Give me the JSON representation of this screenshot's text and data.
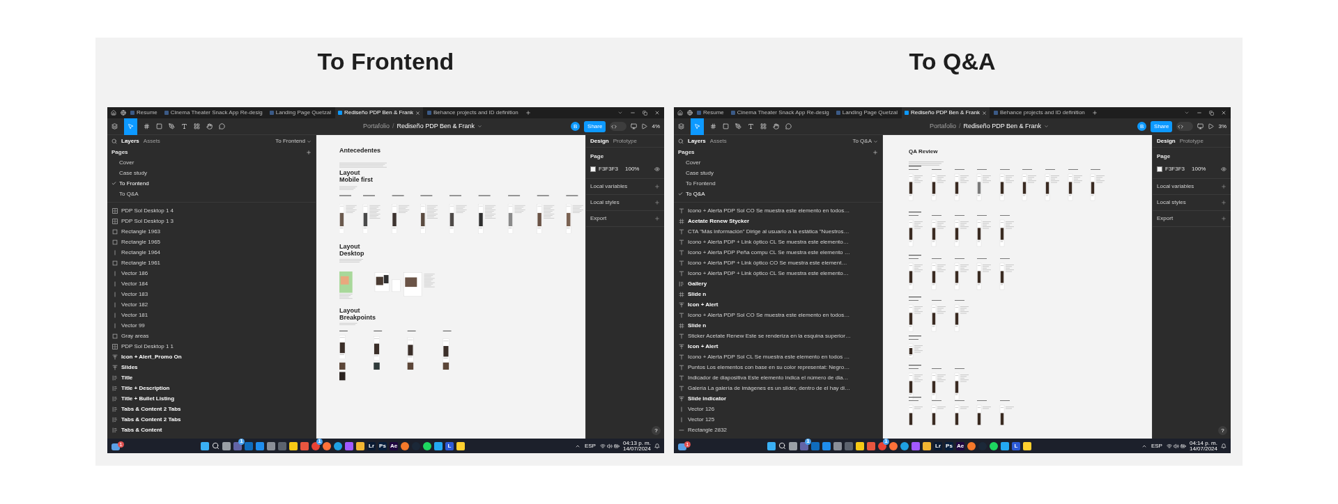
{
  "panels": [
    {
      "heading": "To Frontend",
      "window": {
        "tabs": [
          {
            "label": "Resume",
            "selected": false
          },
          {
            "label": "Cinema Theater Snack App Re-desig",
            "selected": false
          },
          {
            "label": "Landing Page Quetzal",
            "selected": false
          },
          {
            "label": "Rediseño PDP Ben & Frank",
            "selected": true
          },
          {
            "label": "Behance projects and ID definition",
            "selected": false
          }
        ],
        "project": "Portafolio",
        "separator": "/",
        "file": "Rediseño PDP Ben & Frank",
        "avatar": "B",
        "share": "Share",
        "dev_mode": false,
        "zoom": "4%",
        "sidebar": {
          "tabs": [
            {
              "label": "Layers",
              "selected": true
            },
            {
              "label": "Assets",
              "selected": false
            }
          ],
          "current_page": "To Frontend",
          "pages_title": "Pages",
          "pages": [
            {
              "label": "Cover",
              "selected": false
            },
            {
              "label": "Case study",
              "selected": false
            },
            {
              "label": "To Frontend",
              "selected": true
            },
            {
              "label": "To Q&A",
              "selected": false
            }
          ],
          "layers": [
            {
              "label": "PDP Sol Desktop 1 4",
              "kind": "frame"
            },
            {
              "label": "PDP Sol Desktop 1 3",
              "kind": "frame"
            },
            {
              "label": "Rectangle 1963",
              "kind": "rect"
            },
            {
              "label": "Rectangle 1965",
              "kind": "rect"
            },
            {
              "label": "Rectangle 1964",
              "kind": "vector"
            },
            {
              "label": "Rectangle 1961",
              "kind": "rect"
            },
            {
              "label": "Vector 186",
              "kind": "vector"
            },
            {
              "label": "Vector 184",
              "kind": "vector"
            },
            {
              "label": "Vector 183",
              "kind": "vector"
            },
            {
              "label": "Vector 182",
              "kind": "vector"
            },
            {
              "label": "Vector 181",
              "kind": "vector"
            },
            {
              "label": "Vector 99",
              "kind": "vector"
            },
            {
              "label": "Gray areas",
              "kind": "rect"
            },
            {
              "label": "PDP Sol Desktop 1 1",
              "kind": "frame"
            },
            {
              "label": "Icon + Alert_Promo On",
              "kind": "instance"
            },
            {
              "label": "Slides",
              "kind": "instance"
            },
            {
              "label": "Title",
              "kind": "autolayout"
            },
            {
              "label": "Title + Description",
              "kind": "autolayout"
            },
            {
              "label": "Title + Bullet Listing",
              "kind": "autolayout"
            },
            {
              "label": "Tabs & Content 2 Tabs",
              "kind": "autolayout"
            },
            {
              "label": "Tabs & Content 2 Tabs",
              "kind": "autolayout"
            },
            {
              "label": "Tabs & Content",
              "kind": "autolayout"
            }
          ]
        },
        "canvas": {
          "kind": "frontend",
          "headings": [
            "Antecedentes",
            "Layout\nMobile first",
            "Layout\nDesktop",
            "Layout\nBreakpoints"
          ]
        },
        "design": {
          "tabs": [
            {
              "label": "Design",
              "selected": true
            },
            {
              "label": "Prototype",
              "selected": false
            }
          ],
          "page_title": "Page",
          "page_color": "F3F3F3",
          "opacity": "100%",
          "sections": [
            "Local variables",
            "Local styles",
            "Export"
          ]
        },
        "help": "?",
        "taskbar": {
          "widget_badge": "1",
          "apps": [
            {
              "kind": "windows",
              "color": "#3ab0f5"
            },
            {
              "kind": "search"
            },
            {
              "kind": "tile",
              "color": "#9aa0a6"
            },
            {
              "kind": "tile",
              "color": "#6264a7",
              "badge": "1"
            },
            {
              "kind": "tile",
              "color": "#0f6cbd"
            },
            {
              "kind": "tile",
              "color": "#1f8ded"
            },
            {
              "kind": "tile",
              "color": "#8a8f98"
            },
            {
              "kind": "tile",
              "color": "#5c636e"
            },
            {
              "kind": "tile",
              "color": "#f6c915"
            },
            {
              "kind": "tile",
              "color": "#e8563f"
            },
            {
              "kind": "circle",
              "color": "#e94235",
              "badge": "1"
            },
            {
              "kind": "circle",
              "color": "#ff7139"
            },
            {
              "kind": "circle",
              "color": "#1fa1e3"
            },
            {
              "kind": "tile",
              "color": "#a259ff"
            },
            {
              "kind": "tile",
              "color": "#f2b632"
            },
            {
              "kind": "tile",
              "color": "#0a1b33",
              "label": "Lr"
            },
            {
              "kind": "tile",
              "color": "#061e3c",
              "label": "Ps"
            },
            {
              "kind": "tile",
              "color": "#1f0740",
              "label": "Ae"
            },
            {
              "kind": "circle",
              "color": "#f5792a"
            },
            {
              "kind": "circle",
              "color": "#1b2838"
            },
            {
              "kind": "circle",
              "color": "#1ed760"
            },
            {
              "kind": "tile",
              "color": "#23a9f2"
            },
            {
              "kind": "tile",
              "color": "#2d5bd6",
              "label": "L"
            },
            {
              "kind": "tile",
              "color": "#ffd02f"
            }
          ],
          "language": "ESP",
          "time": "04:13 p. m.",
          "date": "14/07/2024"
        }
      }
    },
    {
      "heading": "To Q&A",
      "window": {
        "tabs": [
          {
            "label": "Resume",
            "selected": false
          },
          {
            "label": "Cinema Theater Snack App Re-desig",
            "selected": false
          },
          {
            "label": "Landing Page Quetzal",
            "selected": false
          },
          {
            "label": "Rediseño PDP Ben & Frank",
            "selected": true
          },
          {
            "label": "Behance projects and ID definition",
            "selected": false
          }
        ],
        "project": "Portafolio",
        "separator": "/",
        "file": "Rediseño PDP Ben & Frank",
        "avatar": "B",
        "share": "Share",
        "dev_mode": false,
        "zoom": "3%",
        "sidebar": {
          "tabs": [
            {
              "label": "Layers",
              "selected": true
            },
            {
              "label": "Assets",
              "selected": false
            }
          ],
          "current_page": "To Q&A",
          "pages_title": "Pages",
          "pages": [
            {
              "label": "Cover",
              "selected": false
            },
            {
              "label": "Case study",
              "selected": false
            },
            {
              "label": "To Frontend",
              "selected": false
            },
            {
              "label": "To Q&A",
              "selected": true
            }
          ],
          "layers": [
            {
              "label": "Icono + Alerta PDP Sol CO Se muestra este elemento en todos…",
              "kind": "text"
            },
            {
              "label": "Acetate Renew Stycker",
              "kind": "group"
            },
            {
              "label": "CTA \"Más información\" Dirige al usuario a la estática \"Nuestros…",
              "kind": "text"
            },
            {
              "label": "Icono + Alerta PDP + Link óptico CL Se muestra este elemento…",
              "kind": "text"
            },
            {
              "label": "Icono + Alerta PDP Peña compu CL Se muestra este elemento …",
              "kind": "text"
            },
            {
              "label": "Icono + Alerta PDP + Link óptico CO Se muestra este element…",
              "kind": "text"
            },
            {
              "label": "Icono + Alerta PDP + Link óptico CL Se muestra este elemento…",
              "kind": "text"
            },
            {
              "label": "Gallery",
              "kind": "autolayout"
            },
            {
              "label": "Slide n",
              "kind": "group"
            },
            {
              "label": "Icon + Alert",
              "kind": "instance"
            },
            {
              "label": "Icono + Alerta PDP Sol CO Se muestra este elemento en todos…",
              "kind": "text"
            },
            {
              "label": "Slide n",
              "kind": "group"
            },
            {
              "label": "Sticker Acetate Renew Este se renderiza en la esquina superior…",
              "kind": "text"
            },
            {
              "label": "Icon + Alert",
              "kind": "instance"
            },
            {
              "label": "Icono + Alerta PDP Sol CL Se muestra este elemento en todos …",
              "kind": "text"
            },
            {
              "label": "Puntos Los elementos con base en su color representat: Negro…",
              "kind": "text"
            },
            {
              "label": "Indicador de diapositiva Este elemento indica el número de dia…",
              "kind": "text"
            },
            {
              "label": "Galería La galería de imágenes es un slider, dentro de el hay di…",
              "kind": "text"
            },
            {
              "label": "Slide indicator",
              "kind": "instance"
            },
            {
              "label": "Vector 126",
              "kind": "vector"
            },
            {
              "label": "Vector 125",
              "kind": "vector"
            },
            {
              "label": "Rectangle 2832",
              "kind": "line"
            }
          ]
        },
        "canvas": {
          "kind": "qa",
          "headings": [
            "QA Review"
          ]
        },
        "design": {
          "tabs": [
            {
              "label": "Design",
              "selected": true
            },
            {
              "label": "Prototype",
              "selected": false
            }
          ],
          "page_title": "Page",
          "page_color": "F3F3F3",
          "opacity": "100%",
          "sections": [
            "Local variables",
            "Local styles",
            "Export"
          ]
        },
        "help": "?",
        "taskbar": {
          "widget_badge": "1",
          "apps": [
            {
              "kind": "windows",
              "color": "#3ab0f5"
            },
            {
              "kind": "search"
            },
            {
              "kind": "tile",
              "color": "#9aa0a6"
            },
            {
              "kind": "tile",
              "color": "#6264a7",
              "badge": "1"
            },
            {
              "kind": "tile",
              "color": "#0f6cbd"
            },
            {
              "kind": "tile",
              "color": "#1f8ded"
            },
            {
              "kind": "tile",
              "color": "#8a8f98"
            },
            {
              "kind": "tile",
              "color": "#5c636e"
            },
            {
              "kind": "tile",
              "color": "#f6c915"
            },
            {
              "kind": "tile",
              "color": "#e8563f"
            },
            {
              "kind": "circle",
              "color": "#e94235",
              "badge": "1"
            },
            {
              "kind": "circle",
              "color": "#ff7139"
            },
            {
              "kind": "circle",
              "color": "#1fa1e3"
            },
            {
              "kind": "tile",
              "color": "#a259ff"
            },
            {
              "kind": "tile",
              "color": "#f2b632"
            },
            {
              "kind": "tile",
              "color": "#0a1b33",
              "label": "Lr"
            },
            {
              "kind": "tile",
              "color": "#061e3c",
              "label": "Ps"
            },
            {
              "kind": "tile",
              "color": "#1f0740",
              "label": "Ae"
            },
            {
              "kind": "circle",
              "color": "#f5792a"
            },
            {
              "kind": "circle",
              "color": "#1b2838"
            },
            {
              "kind": "circle",
              "color": "#1ed760"
            },
            {
              "kind": "tile",
              "color": "#23a9f2"
            },
            {
              "kind": "tile",
              "color": "#2d5bd6",
              "label": "L"
            },
            {
              "kind": "tile",
              "color": "#ffd02f"
            }
          ],
          "language": "ESP",
          "time": "04:14 p. m.",
          "date": "14/07/2024"
        }
      }
    }
  ]
}
